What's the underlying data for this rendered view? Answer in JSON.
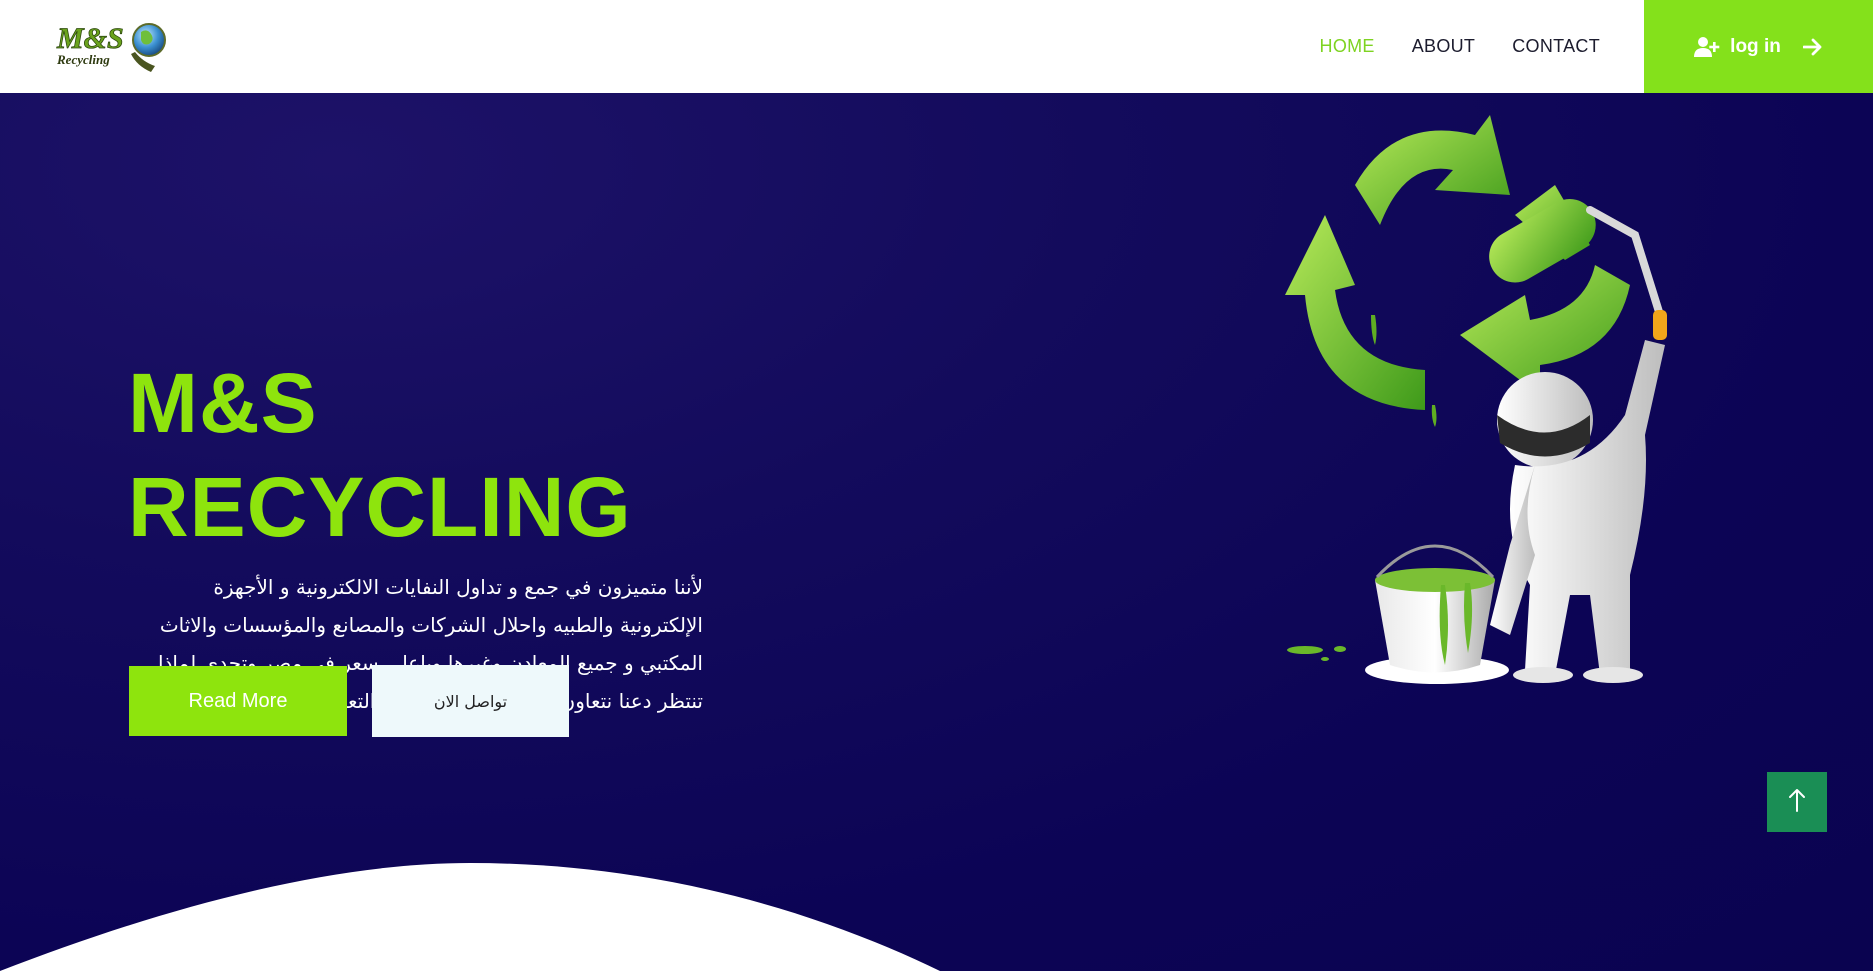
{
  "logo": {
    "main": "M&S",
    "sub": "Recycling"
  },
  "nav": {
    "items": [
      {
        "label": "HOME",
        "active": true
      },
      {
        "label": "ABOUT",
        "active": false
      },
      {
        "label": "CONTACT",
        "active": false
      }
    ],
    "login_label": "log in"
  },
  "hero": {
    "title_line1": "M&S",
    "title_line2": "RECYCLING",
    "description": "لأننا متميزون في جمع و تداول النفايات الالكترونية و الأجهزة الإلكترونية والطبيه واحلال الشركات والمصانع والمؤسسات والاثاث المكتبي و جميع المعادن وغيرها وباعلى سعر في مصر وتحدي لماذا تنتظر دعنا نتعاون سوياً يشرفنا ويسعدنا التعاون معكم.",
    "read_more_label": "Read More",
    "contact_label": "تواصل الان"
  },
  "colors": {
    "accent": "#8ee40d",
    "login_bg": "#84e11b",
    "hero_bg": "#0c0455",
    "scroll_top_bg": "#1a8e55"
  },
  "icons": {
    "login": "user-plus-icon",
    "login_arrow": "arrow-right-icon",
    "scroll_top": "arrow-up-icon"
  }
}
